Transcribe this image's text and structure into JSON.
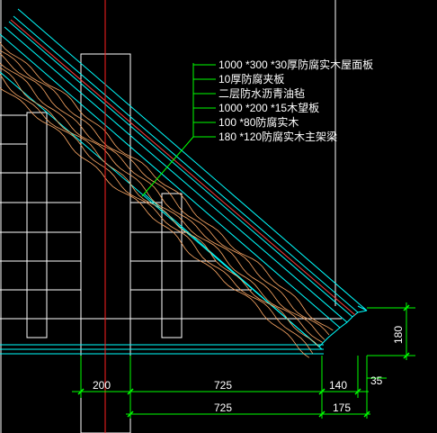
{
  "callout": {
    "labels": [
      "1000 *300 *30厚防腐实木屋面板",
      "10厚防腐夹板",
      "二层防水沥青油毡",
      "1000 *200 *15木望板",
      "100 *80防腐实木",
      "180 *120防腐实木主架梁"
    ]
  },
  "dimensions": {
    "upper_row": [
      "200",
      "725",
      "140"
    ],
    "lower_row": [
      "725",
      "175"
    ],
    "vertical_right": "180",
    "offset_right": "35"
  },
  "colors": {
    "background": "#000000",
    "line_white": "#ffffff",
    "line_cyan": "#00ffff",
    "line_green": "#00ff00",
    "line_red": "#ff2020",
    "wood_grain": "#ffaa66",
    "rafter_red": "#ff4040"
  }
}
